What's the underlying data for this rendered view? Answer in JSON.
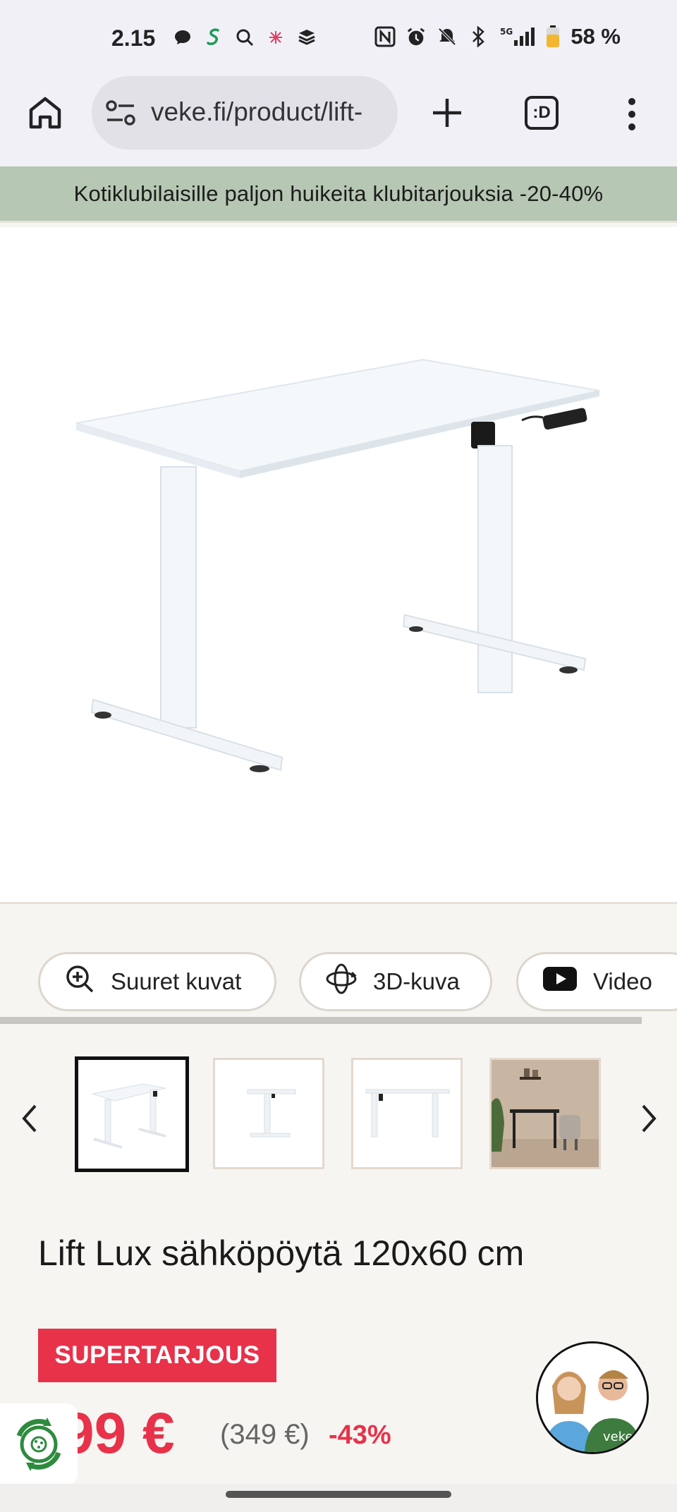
{
  "status_bar": {
    "time": "2.15",
    "battery_percent": "58 %",
    "network": "5G",
    "icons": [
      "chat-bubble-icon",
      "s-app-icon",
      "search-icon",
      "asterisk-icon",
      "layers-icon",
      "nfc-icon",
      "alarm-icon",
      "bell-off-icon",
      "bluetooth-icon",
      "signal-icon",
      "battery-icon"
    ]
  },
  "browser": {
    "url": "veke.fi/product/lift-",
    "tab_count_label": ":D"
  },
  "promo": {
    "text": "Kotiklubilaisille paljon huikeita klubitarjouksia -20-40%",
    "background": "#b6c7b3"
  },
  "actions": [
    {
      "label": "Suuret kuvat",
      "icon": "zoom-in-icon"
    },
    {
      "label": "3D-kuva",
      "icon": "rotate-3d-icon"
    },
    {
      "label": "Video",
      "icon": "youtube-icon"
    }
  ],
  "thumbnails": {
    "count_visible": 4,
    "selected_index": 0
  },
  "product": {
    "title": "Lift Lux sähköpöytä 120x60 cm",
    "badge": "SUPERTARJOUS",
    "price": "99 €",
    "old_price": "(349 €)",
    "discount": "-43%"
  },
  "colors": {
    "accent": "#e8324a",
    "promo": "#b6c7b3",
    "background": "#f7f5f2"
  }
}
